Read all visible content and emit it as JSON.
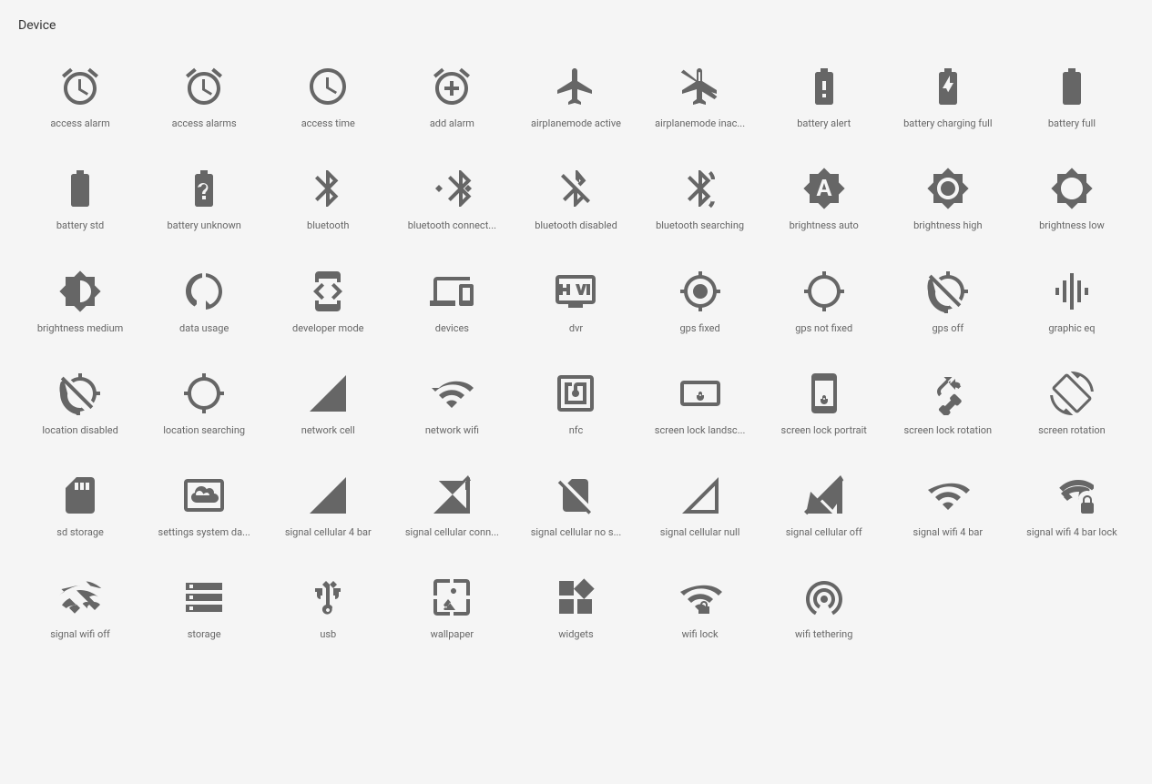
{
  "page": {
    "title": "Device"
  },
  "icons": [
    {
      "id": "access-alarm",
      "label": "access alarm"
    },
    {
      "id": "access-alarms",
      "label": "access alarms"
    },
    {
      "id": "access-time",
      "label": "access time"
    },
    {
      "id": "add-alarm",
      "label": "add alarm"
    },
    {
      "id": "airplanemode-active",
      "label": "airplanemode active"
    },
    {
      "id": "airplanemode-inactive",
      "label": "airplanemode inac..."
    },
    {
      "id": "battery-alert",
      "label": "battery alert"
    },
    {
      "id": "battery-charging-full",
      "label": "battery charging full"
    },
    {
      "id": "battery-full",
      "label": "battery full"
    },
    {
      "id": "battery-std",
      "label": "battery std"
    },
    {
      "id": "battery-unknown",
      "label": "battery unknown"
    },
    {
      "id": "bluetooth",
      "label": "bluetooth"
    },
    {
      "id": "bluetooth-connected",
      "label": "bluetooth connect..."
    },
    {
      "id": "bluetooth-disabled",
      "label": "bluetooth disabled"
    },
    {
      "id": "bluetooth-searching",
      "label": "bluetooth searching"
    },
    {
      "id": "brightness-auto",
      "label": "brightness auto"
    },
    {
      "id": "brightness-high",
      "label": "brightness high"
    },
    {
      "id": "brightness-low",
      "label": "brightness low"
    },
    {
      "id": "brightness-medium",
      "label": "brightness medium"
    },
    {
      "id": "data-usage",
      "label": "data usage"
    },
    {
      "id": "developer-mode",
      "label": "developer mode"
    },
    {
      "id": "devices",
      "label": "devices"
    },
    {
      "id": "dvr",
      "label": "dvr"
    },
    {
      "id": "gps-fixed",
      "label": "gps fixed"
    },
    {
      "id": "gps-not-fixed",
      "label": "gps not fixed"
    },
    {
      "id": "gps-off",
      "label": "gps off"
    },
    {
      "id": "graphic-eq",
      "label": "graphic eq"
    },
    {
      "id": "location-disabled",
      "label": "location disabled"
    },
    {
      "id": "location-searching",
      "label": "location searching"
    },
    {
      "id": "network-cell",
      "label": "network cell"
    },
    {
      "id": "network-wifi",
      "label": "network wifi"
    },
    {
      "id": "nfc",
      "label": "nfc"
    },
    {
      "id": "screen-lock-landscape",
      "label": "screen lock landsc..."
    },
    {
      "id": "screen-lock-portrait",
      "label": "screen lock portrait"
    },
    {
      "id": "screen-lock-rotation",
      "label": "screen lock rotation"
    },
    {
      "id": "screen-rotation",
      "label": "screen rotation"
    },
    {
      "id": "sd-storage",
      "label": "sd storage"
    },
    {
      "id": "settings-system-daydream",
      "label": "settings system da..."
    },
    {
      "id": "signal-cellular-4bar",
      "label": "signal cellular 4 bar"
    },
    {
      "id": "signal-cellular-connected",
      "label": "signal cellular conn..."
    },
    {
      "id": "signal-cellular-no-sim",
      "label": "signal cellular no s..."
    },
    {
      "id": "signal-cellular-null",
      "label": "signal cellular null"
    },
    {
      "id": "signal-cellular-off",
      "label": "signal cellular off"
    },
    {
      "id": "signal-wifi-4bar",
      "label": "signal wifi 4 bar"
    },
    {
      "id": "signal-wifi-4bar-lock",
      "label": "signal wifi 4 bar lock"
    },
    {
      "id": "signal-wifi-off",
      "label": "signal wifi off"
    },
    {
      "id": "storage",
      "label": "storage"
    },
    {
      "id": "usb",
      "label": "usb"
    },
    {
      "id": "wallpaper",
      "label": "wallpaper"
    },
    {
      "id": "widgets",
      "label": "widgets"
    },
    {
      "id": "wifi-lock",
      "label": "wifi lock"
    },
    {
      "id": "wifi-tethering",
      "label": "wifi tethering"
    }
  ]
}
